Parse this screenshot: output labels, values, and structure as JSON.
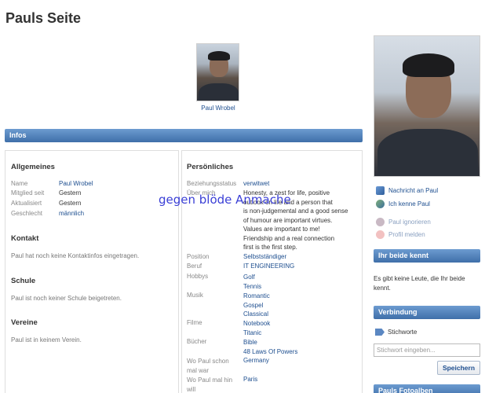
{
  "page": {
    "title": "Pauls Seite"
  },
  "profile": {
    "name": "Paul Wrobel"
  },
  "infos_bar": "Infos",
  "allgemeines": {
    "title": "Allgemeines",
    "rows": [
      {
        "label": "Name",
        "value": "Paul Wrobel"
      },
      {
        "label": "Mitglied seit",
        "value": "Gestern"
      },
      {
        "label": "Aktualisiert",
        "value": "Gestern"
      },
      {
        "label": "Geschlecht",
        "value": "männlich"
      }
    ]
  },
  "kontakt": {
    "title": "Kontakt",
    "text": "Paul hat noch keine Kontaktinfos eingetragen."
  },
  "schule": {
    "title": "Schule",
    "text": "Paul ist noch keiner Schule beigetreten."
  },
  "vereine": {
    "title": "Vereine",
    "text": "Paul ist in keinem Verein."
  },
  "persoenliches": {
    "title": "Persönliches",
    "beziehung": {
      "label": "Beziehungsstatus",
      "value": "verwitwet"
    },
    "ueber_mich": {
      "label": "Über mich",
      "lines": [
        "Honesty, a zest for life, positive",
        "outlook on life and a person that",
        "is non-judgemental and a good sense",
        "of humour are important virtues.",
        "Values are important to me!",
        "Friendship and a real connection",
        "first is the first step."
      ]
    },
    "position": {
      "label": "Position",
      "value": "Selbstständiger"
    },
    "beruf": {
      "label": "Beruf",
      "value": "IT ENGINEERING"
    },
    "hobbys": {
      "label": "Hobbys",
      "values": [
        "Golf",
        "Tennis"
      ]
    },
    "musik": {
      "label": "Musik",
      "values": [
        "Romantic",
        "Gospel",
        "Classical"
      ]
    },
    "filme": {
      "label": "Filme",
      "values": [
        "Notebook",
        "Titanic"
      ]
    },
    "buecher": {
      "label": "Bücher",
      "values": [
        "Bible",
        "48 Laws Of Powers"
      ]
    },
    "wo_war": {
      "label_lines": [
        "Wo Paul schon",
        "mal war"
      ],
      "value": "Germany"
    },
    "wo_will": {
      "label_lines": [
        "Wo Paul mal hin",
        "will"
      ],
      "value": "Paris"
    }
  },
  "watermark": "gegen blöde Anmache",
  "actions": {
    "nachricht": "Nachricht an Paul",
    "kenne": "Ich kenne Paul",
    "ignorieren": "Paul ignorieren",
    "melden": "Profil melden"
  },
  "ihr_beide": {
    "title": "Ihr beide kennt",
    "text": "Es gibt keine Leute, die Ihr beide kennt."
  },
  "verbindung": {
    "title": "Verbindung",
    "stichworte": "Stichworte",
    "input_placeholder": "Stichwort eingeben...",
    "save": "Speichern"
  },
  "fotoalben": {
    "title": "Pauls Fotoalben"
  },
  "colors": {
    "accent": "#3f6fa9",
    "link": "#1d4e8f",
    "watermark": "#3a3fd6"
  }
}
